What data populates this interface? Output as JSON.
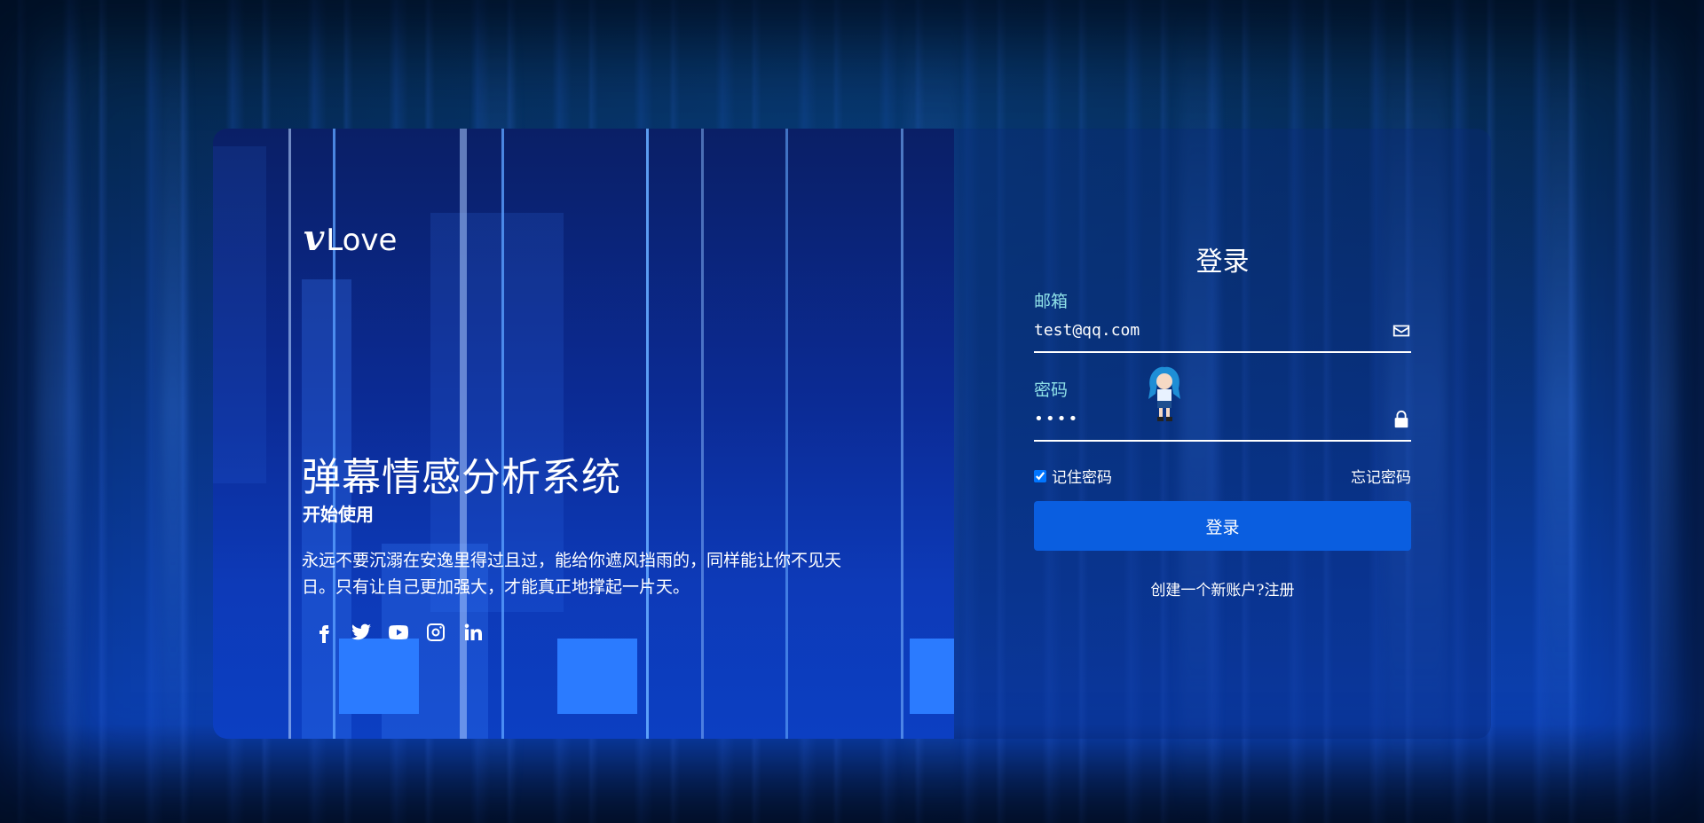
{
  "brand": {
    "logo_mark": "v",
    "logo_text": "Love"
  },
  "hero": {
    "title": "弹幕情感分析系统",
    "subtitle": "开始使用",
    "quote": "永远不要沉溺在安逸里得过且过，能给你遮风挡雨的，同样能让你不见天日。只有让自己更加强大，才能真正地撑起一片天。"
  },
  "social": [
    "facebook-icon",
    "twitter-icon",
    "youtube-icon",
    "instagram-icon",
    "linkedin-icon"
  ],
  "login": {
    "title": "登录",
    "email_label": "邮箱",
    "email_value": "test@qq.com",
    "password_label": "密码",
    "password_value": "••••",
    "remember_label": "记住密码",
    "remember_checked": true,
    "forgot_label": "忘记密码",
    "submit_label": "登录",
    "register_text": "创建一个新账户?注册"
  },
  "colors": {
    "accent": "#0a5ee0",
    "label": "#8fe1e8",
    "text": "#ffffff"
  }
}
